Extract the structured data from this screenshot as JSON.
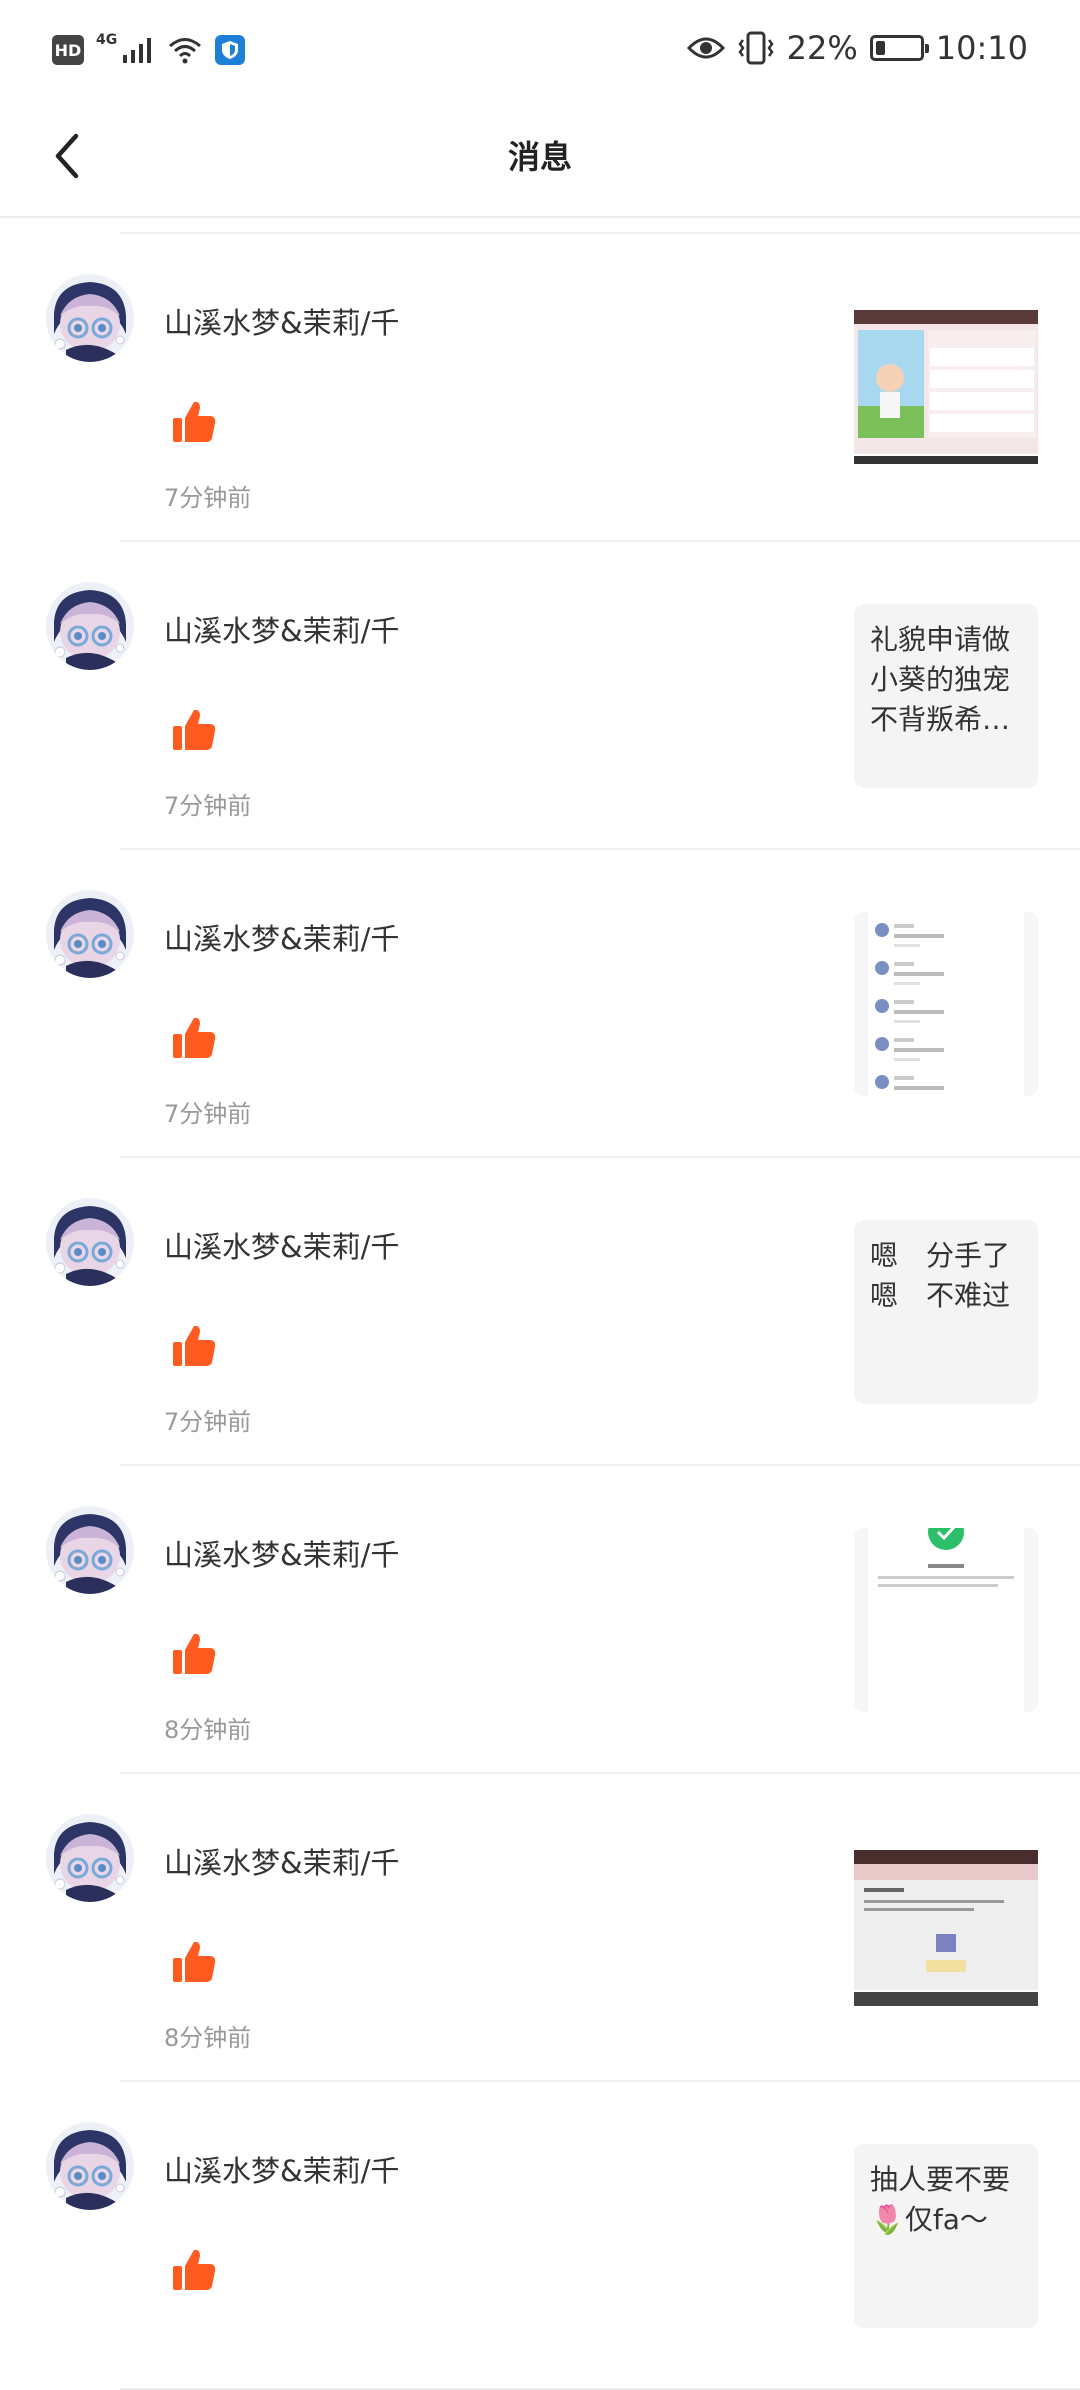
{
  "status_bar": {
    "hd": "HD",
    "network": "4G",
    "battery_percent": "22%",
    "battery_level": 0.22,
    "time": "10:10"
  },
  "header": {
    "title": "消息"
  },
  "messages": [
    {
      "username": "山溪水梦&茉莉/千",
      "time": "7分钟前",
      "preview_type": "image",
      "preview_text": ""
    },
    {
      "username": "山溪水梦&茉莉/千",
      "time": "7分钟前",
      "preview_type": "text",
      "preview_text": "礼貌申请做小葵的独宠不背叛希…"
    },
    {
      "username": "山溪水梦&茉莉/千",
      "time": "7分钟前",
      "preview_type": "image",
      "preview_text": ""
    },
    {
      "username": "山溪水梦&茉莉/千",
      "time": "7分钟前",
      "preview_type": "text",
      "preview_text": "嗯　分手了\n嗯　不难过"
    },
    {
      "username": "山溪水梦&茉莉/千",
      "time": "8分钟前",
      "preview_type": "image",
      "preview_text": ""
    },
    {
      "username": "山溪水梦&茉莉/千",
      "time": "8分钟前",
      "preview_type": "image",
      "preview_text": ""
    },
    {
      "username": "山溪水梦&茉莉/千",
      "time": "",
      "preview_type": "text",
      "preview_text": "抽人要不要\n🌷仅fa～"
    }
  ],
  "colors": {
    "like": "#ff5a1f",
    "divider": "#efefef",
    "muted_text": "#999999"
  },
  "icons": {
    "back": "chevron-left-icon",
    "like": "thumbs-up-icon"
  }
}
